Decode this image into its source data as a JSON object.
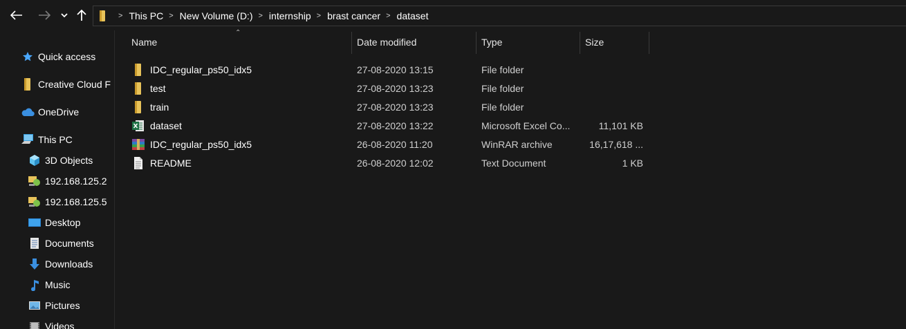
{
  "address": {
    "crumbs": [
      "This PC",
      "New Volume (D:)",
      "internship",
      "brast cancer",
      "dataset"
    ]
  },
  "nav": {
    "items": [
      {
        "label": "Quick access",
        "icon": "star-icon"
      },
      {
        "label": "Creative Cloud F",
        "icon": "folder-icon"
      },
      {
        "label": "OneDrive",
        "icon": "cloud-icon"
      },
      {
        "label": "This PC",
        "icon": "computer-icon"
      },
      {
        "label": "3D Objects",
        "icon": "cube-icon"
      },
      {
        "label": "192.168.125.2",
        "icon": "network-drive-icon"
      },
      {
        "label": "192.168.125.5",
        "icon": "network-drive-icon"
      },
      {
        "label": "Desktop",
        "icon": "desktop-icon"
      },
      {
        "label": "Documents",
        "icon": "document-icon"
      },
      {
        "label": "Downloads",
        "icon": "download-icon"
      },
      {
        "label": "Music",
        "icon": "music-note-icon"
      },
      {
        "label": "Pictures",
        "icon": "picture-icon"
      },
      {
        "label": "Videos",
        "icon": "video-icon"
      }
    ]
  },
  "columns": {
    "name": "Name",
    "date": "Date modified",
    "type": "Type",
    "size": "Size"
  },
  "files": [
    {
      "name": "IDC_regular_ps50_idx5",
      "date": "27-08-2020 13:15",
      "type": "File folder",
      "size": "",
      "icon": "folder-icon"
    },
    {
      "name": "test",
      "date": "27-08-2020 13:23",
      "type": "File folder",
      "size": "",
      "icon": "folder-icon"
    },
    {
      "name": "train",
      "date": "27-08-2020 13:23",
      "type": "File folder",
      "size": "",
      "icon": "folder-icon"
    },
    {
      "name": "dataset",
      "date": "27-08-2020 13:22",
      "type": "Microsoft Excel Co...",
      "size": "11,101 KB",
      "icon": "excel-icon"
    },
    {
      "name": "IDC_regular_ps50_idx5",
      "date": "26-08-2020 11:20",
      "type": "WinRAR archive",
      "size": "16,17,618 ...",
      "icon": "winrar-icon"
    },
    {
      "name": "README",
      "date": "26-08-2020 12:02",
      "type": "Text Document",
      "size": "1 KB",
      "icon": "text-file-icon"
    }
  ],
  "colors": {
    "background": "#191919",
    "folder": "#e8c35a",
    "accent": "#b22a2a",
    "star": "#4aa8ff",
    "cloud": "#3a8fe0"
  }
}
